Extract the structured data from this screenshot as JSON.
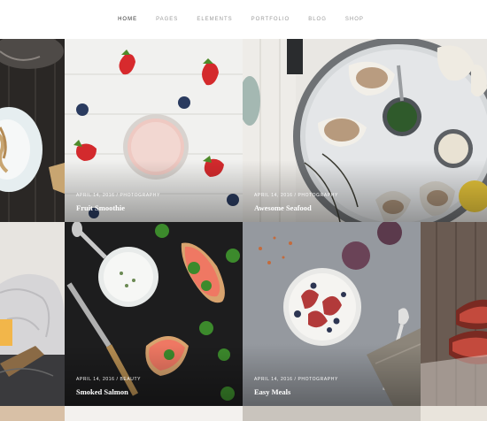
{
  "nav": {
    "items": [
      {
        "label": "HOME",
        "active": true
      },
      {
        "label": "PAGES",
        "active": false
      },
      {
        "label": "ELEMENTS",
        "active": false
      },
      {
        "label": "PORTFOLIO",
        "active": false
      },
      {
        "label": "BLOG",
        "active": false
      },
      {
        "label": "SHOP",
        "active": false
      }
    ]
  },
  "posts": [
    {
      "meta": "APRIL 14, 2016 / PHOTOGRAPHY",
      "title": "Fruit Smoothie"
    },
    {
      "meta": "APRIL 14, 2016 / PHOTOGRAPHY",
      "title": "Awesome Seafood"
    },
    {
      "meta": "APRIL 14, 2016 / BEAUTY",
      "title": "Smoked Salmon"
    },
    {
      "meta": "APRIL 14, 2016 / PHOTOGRAPHY",
      "title": "Easy Meals"
    }
  ]
}
